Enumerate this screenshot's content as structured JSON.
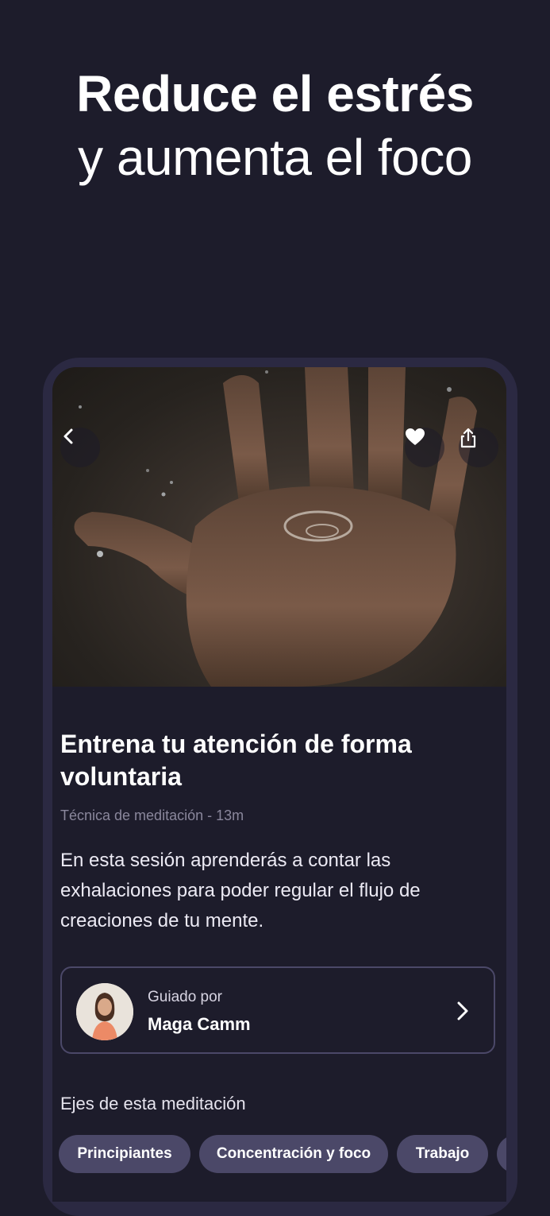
{
  "headline": {
    "line1": "Reduce el estrés",
    "line2": "y aumenta el foco"
  },
  "session": {
    "title": "Entrena tu atención de forma voluntaria",
    "meta": "Técnica de meditación - 13m",
    "description": "En esta sesión aprenderás a contar las exhalaciones para poder regular el flujo de creaciones de tu mente."
  },
  "guide": {
    "label": "Guiado por",
    "name": "Maga Camm"
  },
  "axes": {
    "label": "Ejes de esta meditación",
    "chips": [
      "Principiantes",
      "Concentración y foco",
      "Trabajo"
    ]
  },
  "icons": {
    "back": "chevron-left-icon",
    "favorite": "heart-icon",
    "share": "share-icon",
    "open_guide": "chevron-right-icon"
  },
  "colors": {
    "background": "#1d1c2b",
    "phone_frame": "#2b2942",
    "chip": "#4b4868",
    "meta_text": "#8a879c"
  }
}
